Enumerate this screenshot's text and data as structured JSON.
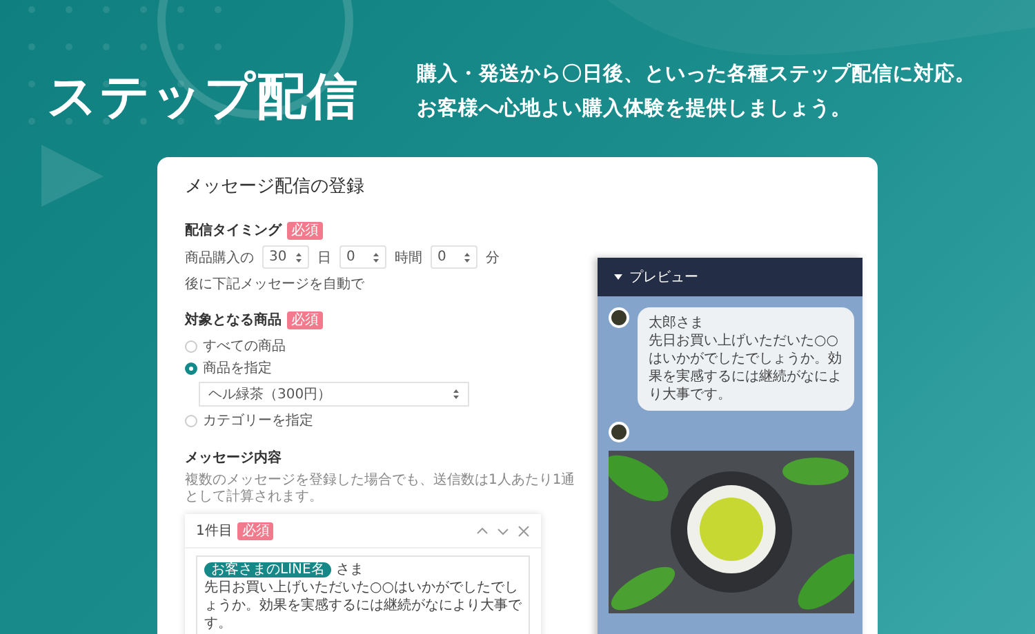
{
  "banner": {
    "title": "ステップ配信",
    "lines": [
      "購入・発送から〇日後、といった各種ステップ配信に対応。",
      "お客様へ心地よい購入体験を提供しましょう。"
    ]
  },
  "form": {
    "title": "メッセージ配信の登録",
    "timing": {
      "label": "配信タイミング",
      "badge": "必須",
      "prefix": "商品購入の",
      "fields": [
        {
          "value": "30",
          "unit": "日"
        },
        {
          "value": "0",
          "unit": "時間"
        },
        {
          "value": "0",
          "unit": "分"
        }
      ],
      "suffix": "後に下記メッセージを自動で"
    },
    "products": {
      "label": "対象となる商品",
      "badge": "必須",
      "options": [
        {
          "label": "すべての商品",
          "selected": false
        },
        {
          "label": "商品を指定",
          "selected": true,
          "select": "ヘル緑茶（300円）"
        },
        {
          "label": "カテゴリーを指定",
          "selected": false
        }
      ]
    },
    "messages": {
      "label": "メッセージ内容",
      "note": "複数のメッセージを登録した場合でも、送信数は1人あたり1通として計算されます。",
      "items": [
        {
          "title": "1件目",
          "badge": "必須",
          "tag": "お客さまのLINE名",
          "after_tag": "さま",
          "text": "先日お買い上げいただいた○○はいかがでしたでしょうか。効果を実感するには継続がなにより大事です。"
        }
      ]
    }
  },
  "preview": {
    "title": "プレビュー",
    "bubbles": [
      {
        "kind": "text",
        "name": "太郎さま",
        "text": "先日お買い上げいただいた○○はいかがでしたでしょうか。効果を実感するには継続がなにより大事です。"
      },
      {
        "kind": "image"
      }
    ]
  }
}
